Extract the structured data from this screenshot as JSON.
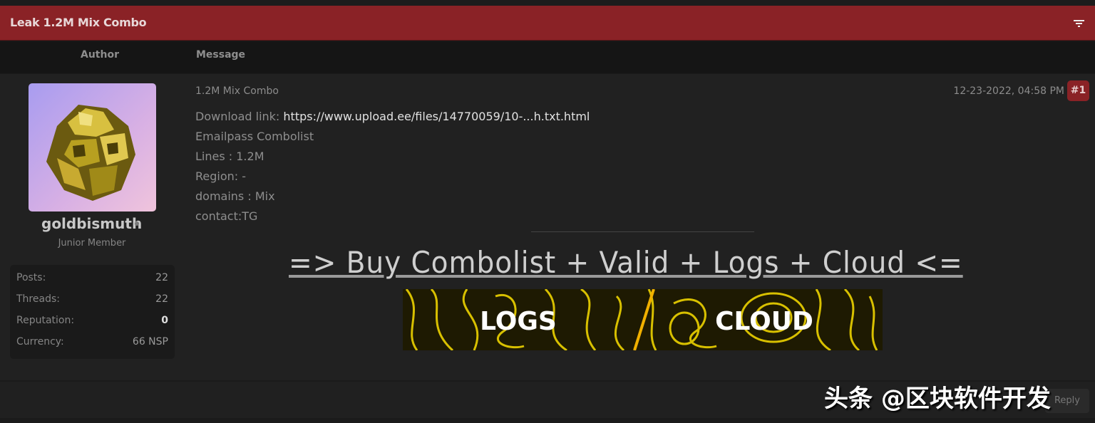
{
  "thread": {
    "title": "Leak 1.2M Mix Combo",
    "filter_icon": "filter-icon"
  },
  "columns": {
    "author": "Author",
    "message": "Message"
  },
  "author": {
    "username": "goldbismuth",
    "rank": "Junior Member",
    "stats": [
      {
        "label": "Posts:",
        "value": "22"
      },
      {
        "label": "Threads:",
        "value": "22"
      },
      {
        "label": "Reputation:",
        "value": "0"
      },
      {
        "label": "Currency:",
        "value": "66 NSP"
      }
    ]
  },
  "post": {
    "subject": "1.2M Mix Combo",
    "date": "12-23-2022, 04:58 PM",
    "number": "#1",
    "download_label": "Download link:",
    "download_url": "https://www.upload.ee/files/14770059/10-...h.txt.html",
    "lines": [
      "Emailpass Combolist",
      "Lines : 1.2M",
      "Region: -",
      "domains : Mix",
      "contact:TG"
    ],
    "promo": "=> Buy Combolist + Valid + Logs + Cloud <=",
    "banner": {
      "left": "LOGS",
      "right": "CLOUD"
    }
  },
  "footer": {
    "reply": "Reply"
  },
  "watermark": "头条 @区块软件开发",
  "colors": {
    "header": "#8a2226",
    "background": "#212121",
    "banner_line": "#d8c000"
  }
}
